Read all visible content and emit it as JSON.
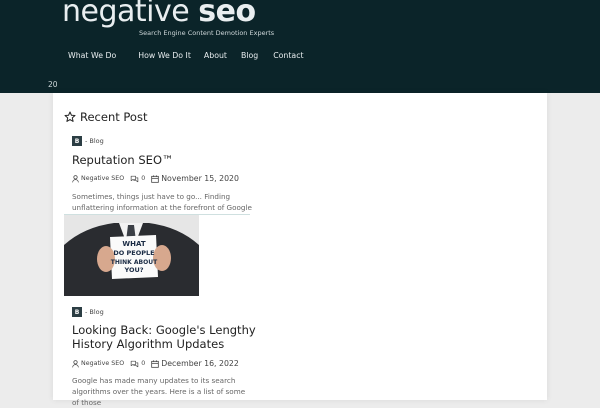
{
  "header": {
    "logo_light": "negative",
    "logo_bold": "seo",
    "tagline": "Search Engine Content Demotion Experts",
    "nav": [
      "What We Do",
      "How We Do It",
      "About",
      "Blog",
      "Contact"
    ],
    "counter": "20"
  },
  "section": {
    "title": "Recent Post"
  },
  "posts": [
    {
      "category_badge": "B",
      "category": "- Blog",
      "title": "Reputation SEO™",
      "author": "Negative SEO",
      "comments": "0",
      "date": "November 15, 2020",
      "excerpt": "Sometimes, things just have to go... Finding unflattering information at the forefront of Google",
      "image_text": "WHAT DO PEOPLE THINK ABOUT YOU?"
    },
    {
      "category_badge": "B",
      "category": "- Blog",
      "title": "Looking Back: Google's Lengthy",
      "title_line2": "History Algorithm Updates",
      "author": "Negative SEO",
      "comments": "0",
      "date": "December 16, 2022",
      "excerpt": "Google has made many updates to its search algorithms over the years. Here is a list of some of those"
    }
  ]
}
